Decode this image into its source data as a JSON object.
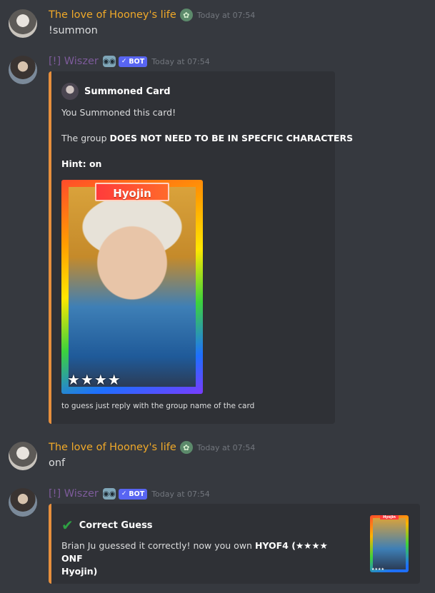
{
  "messages": [
    {
      "username": "The love of Hooney's life",
      "badge_icon": "clover-badge-icon",
      "time": "Today at 07:54",
      "text": "!summon"
    },
    {
      "username": "[!] Wiszer",
      "bot_icon": "robot-icon",
      "bot_tag": "BOT",
      "time": "Today at 07:54",
      "embed": {
        "author": "Summoned Card",
        "line1": "You Summoned this card!",
        "line2_prefix": "The group ",
        "line2_bold": "DOES NOT NEED TO BE IN SPECFIC CHARACTERS",
        "hint": "Hint: on",
        "card_name": "Hyojin",
        "card_stars": "★★★★",
        "footer": "to guess just reply with the group name of the card",
        "accent": "#e68f3d"
      }
    },
    {
      "username": "The love of Hooney's life",
      "badge_icon": "clover-badge-icon",
      "time": "Today at 07:54",
      "text": "onf"
    },
    {
      "username": "[!] Wiszer",
      "bot_icon": "robot-icon",
      "bot_tag": "BOT",
      "time": "Today at 07:54",
      "embed": {
        "title": "Correct Guess",
        "line_prefix": "Brian Ju guessed it correctly! now you own ",
        "line_bold_1": "HYOF4 (★★★★ ONF",
        "line_bold_2": "Hyojin)",
        "thumb_name": "Hyojin",
        "thumb_stars": "★★★★"
      }
    }
  ],
  "colors": {
    "background": "#36393f",
    "embed_bg": "#2f3136",
    "username_user": "#f0a929",
    "username_bot": "#7d5b9b",
    "bot_tag": "#5865f2",
    "check": "#2ea043"
  }
}
